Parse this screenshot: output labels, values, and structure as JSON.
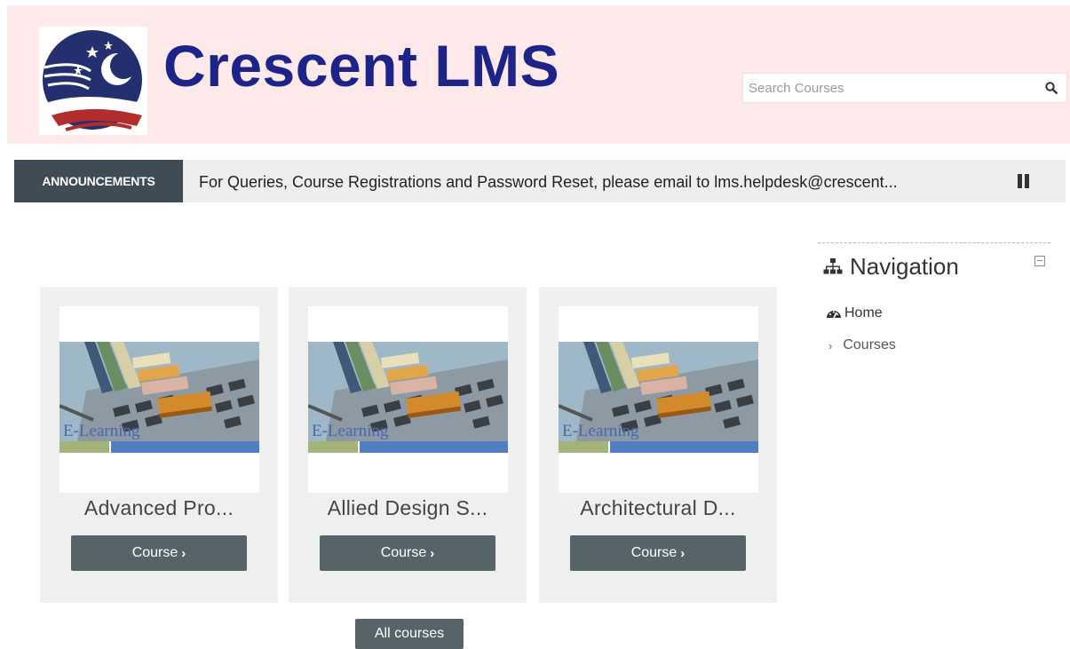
{
  "header": {
    "site_title": "Crescent LMS",
    "logo_icon": "crescent-moon-stars-logo",
    "background_color": "#fde9ea",
    "title_color": "#1c2489"
  },
  "search": {
    "placeholder": "Search Courses",
    "icon": "search-icon"
  },
  "announcement": {
    "tag": "ANNOUNCEMENTS",
    "text": "For Queries, Course Registrations and Password Reset, please email to lms.helpdesk@crescent...",
    "control_icon": "pause-icon"
  },
  "courses": [
    {
      "title": "Advanced Pro...",
      "button_label": "Course",
      "image_caption": "E-Learning"
    },
    {
      "title": "Allied Design S...",
      "button_label": "Course",
      "image_caption": "E-Learning"
    },
    {
      "title": "Architectural D...",
      "button_label": "Course",
      "image_caption": "E-Learning"
    }
  ],
  "all_courses_label": "All courses",
  "navigation": {
    "title": "Navigation",
    "items": [
      {
        "label": "Home",
        "icon": "dashboard-icon"
      },
      {
        "label": "Courses",
        "icon": "chevron-right-icon"
      }
    ]
  },
  "colors": {
    "button": "#566468",
    "announcement_tag": "#3f4c55"
  }
}
